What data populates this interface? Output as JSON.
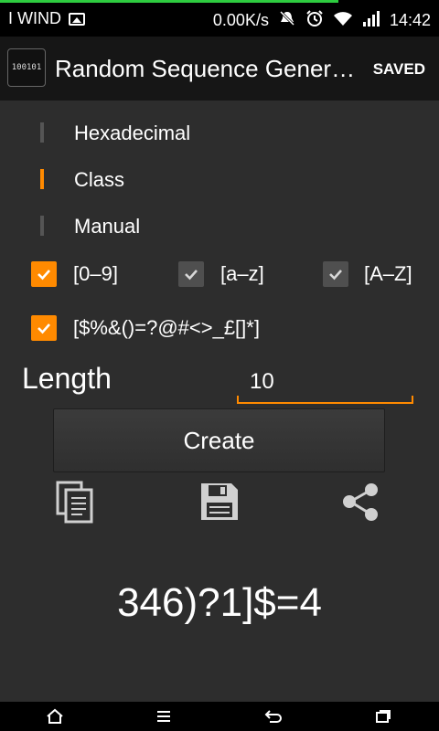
{
  "status_bar": {
    "carrier": "I WIND",
    "speed": "0.00K/s",
    "time": "14:42"
  },
  "action_bar": {
    "app_icon_text": "100101",
    "title": "Random Sequence Gener…",
    "saved_label": "SAVED"
  },
  "modes": [
    {
      "label": "Hexadecimal",
      "active": false
    },
    {
      "label": "Class",
      "active": true
    },
    {
      "label": "Manual",
      "active": false
    }
  ],
  "charsets": [
    {
      "label": "[0–9]",
      "checked": true
    },
    {
      "label": "[a–z]",
      "checked": false
    },
    {
      "label": "[A–Z]",
      "checked": false
    },
    {
      "label": "[$%&()=?@#<>_£[]*]",
      "checked": true
    }
  ],
  "length": {
    "label": "Length",
    "value": "10"
  },
  "create_label": "Create",
  "result": "346)?1]$=4",
  "colors": {
    "accent": "#ff8a00",
    "background": "#2d2d2d",
    "status_green": "#2ecc40"
  },
  "icons": [
    "image-icon",
    "mute-icon",
    "alarm-icon",
    "wifi-icon",
    "signal-icon",
    "copy-icon",
    "save-icon",
    "share-icon",
    "home-icon",
    "menu-icon",
    "back-icon",
    "recents-icon"
  ]
}
